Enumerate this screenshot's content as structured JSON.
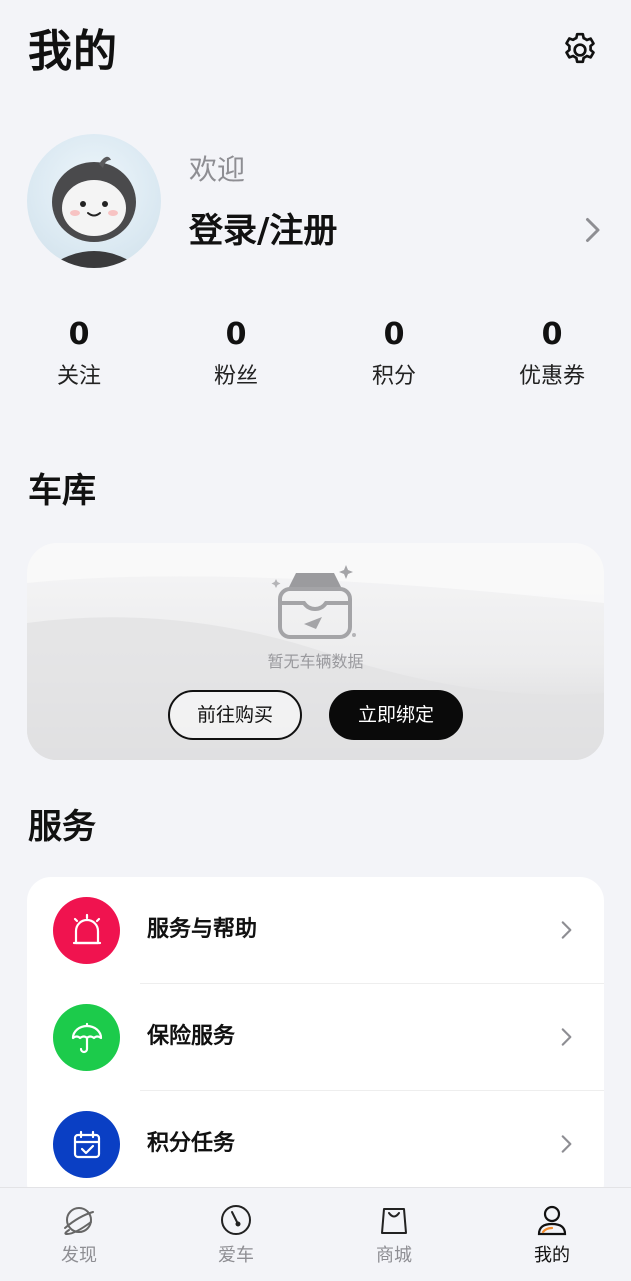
{
  "header": {
    "title": "我的",
    "settings_icon": "gear-icon"
  },
  "profile": {
    "welcome": "欢迎",
    "login_label": "登录/注册",
    "avatar_icon": "default-avatar"
  },
  "stats": [
    {
      "value": "0",
      "label": "关注"
    },
    {
      "value": "0",
      "label": "粉丝"
    },
    {
      "value": "0",
      "label": "积分"
    },
    {
      "value": "0",
      "label": "优惠券"
    }
  ],
  "garage": {
    "title": "车库",
    "empty_text": "暂无车辆数据",
    "buy_button": "前往购买",
    "bind_button": "立即绑定",
    "empty_icon": "empty-inbox-icon"
  },
  "services": {
    "title": "服务",
    "items": [
      {
        "label": "服务与帮助",
        "icon": "alarm-light-icon",
        "color": "#f0134f"
      },
      {
        "label": "保险服务",
        "icon": "umbrella-icon",
        "color": "#1ccb4b"
      },
      {
        "label": "积分任务",
        "icon": "calendar-check-icon",
        "color": "#0a3fc4"
      }
    ]
  },
  "tabbar": {
    "items": [
      {
        "label": "发现",
        "icon": "planet-icon",
        "active": false
      },
      {
        "label": "爱车",
        "icon": "speedometer-icon",
        "active": false
      },
      {
        "label": "商城",
        "icon": "shopping-bag-icon",
        "active": false
      },
      {
        "label": "我的",
        "icon": "person-icon",
        "active": true
      }
    ]
  },
  "colors": {
    "background": "#f3f4f8",
    "primary_text": "#111111",
    "muted_text": "#8e8e93",
    "button_dark": "#0a0a0a"
  }
}
